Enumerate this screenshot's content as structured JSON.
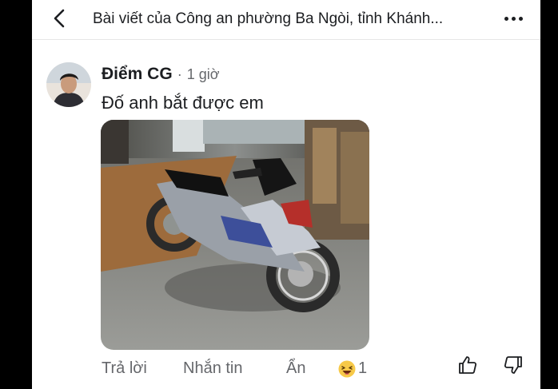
{
  "header": {
    "title": "Bài viết của Công an phường Ba Ngòi, tỉnh Khánh..."
  },
  "comment": {
    "author": "Điểm CG",
    "separator": "·",
    "time": "1 giờ",
    "text": "Đố anh bắt được em",
    "photo": "motorbike-photo"
  },
  "actions": {
    "reply_label": "Trả lời",
    "message_label": "Nhắn tin",
    "hide_label": "Ẩn",
    "reaction_icon": "laughing-emoji-icon",
    "reaction_count": "1"
  },
  "icons": {
    "back": "chevron-left-icon",
    "more": "more-dots-icon",
    "like": "thumbs-up-icon",
    "dislike": "thumbs-down-icon"
  }
}
